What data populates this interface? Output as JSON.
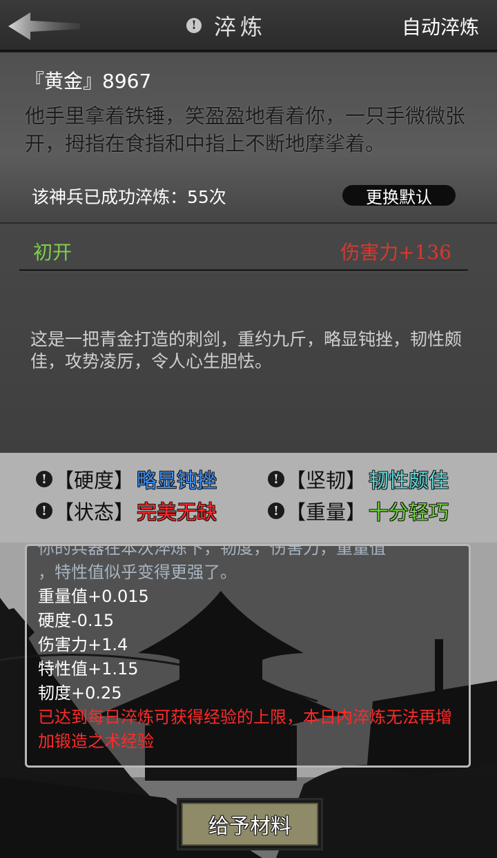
{
  "header": {
    "title": "淬炼",
    "auto_button": "自动淬炼"
  },
  "info": {
    "name_line": "『黄金』8967",
    "description": "他手里拿着铁锤，笑盈盈地看着你，一只手微微张开，拇指在食指和中指上不断地摩挲着。",
    "refine_count": "该神兵已成功淬炼：55次",
    "default_button": "更换默认"
  },
  "weapon": {
    "stage": "初开",
    "damage": "伤害力+136",
    "description": "这是一把青金打造的刺剑，重约九斤，略显钝挫，韧性颇佳，攻势凌厉，令人心生胆怯。"
  },
  "attributes": [
    {
      "label": "【硬度】",
      "value": "略显钝挫",
      "color": "#3d8cf0"
    },
    {
      "label": "【坚韧】",
      "value": "韧性颇佳",
      "color": "#5fd6d8"
    },
    {
      "label": "【状态】",
      "value": "完美无缺",
      "color": "#ff2a2a"
    },
    {
      "label": "【重量】",
      "value": "十分轻巧",
      "color": "#6fd23e"
    }
  ],
  "log": {
    "cut_line": "你的兵器在本次淬炼下，韧度，伤害力，重量值",
    "faded_line": "，特性值似乎变得更强了。",
    "lines": [
      "重量值+0.015",
      "硬度-0.15",
      "伤害力+1.4",
      "特性值+1.15",
      "韧度+0.25"
    ],
    "warning": "已达到每日淬炼可获得经验的上限，本日内淬炼无法再增加锻造之术经验"
  },
  "give_button": "给予材料",
  "icons": {
    "back": "back-arrow-icon",
    "info": "exclamation-icon"
  }
}
